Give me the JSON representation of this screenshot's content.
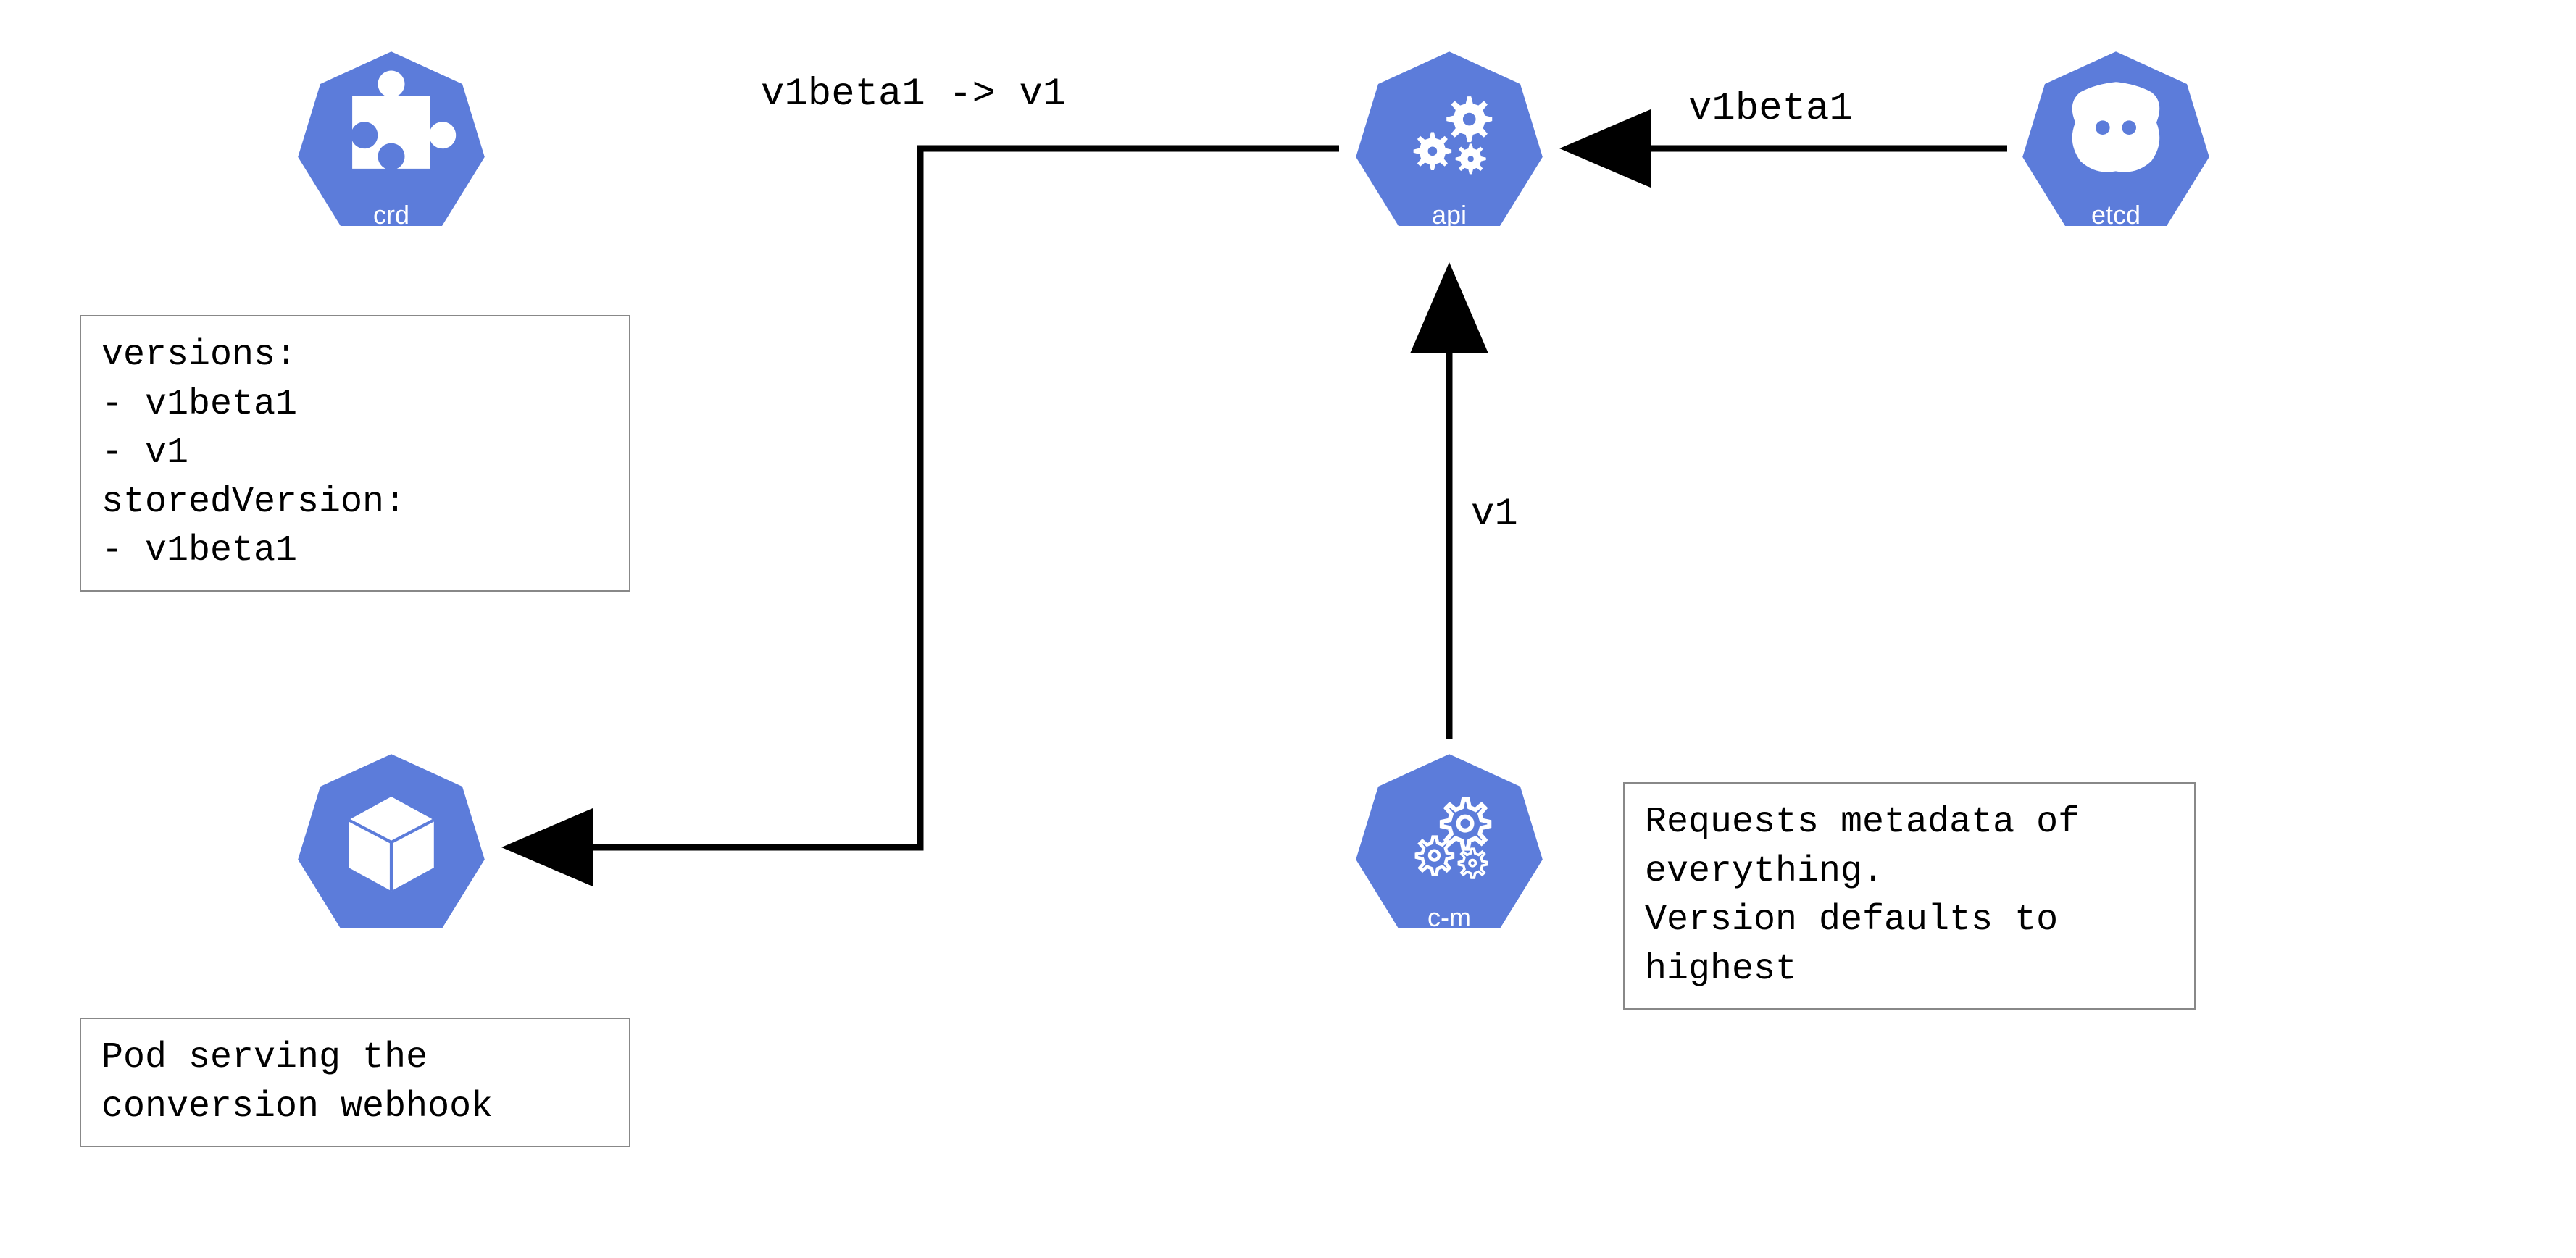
{
  "nodes": {
    "crd": {
      "label": "crd"
    },
    "api": {
      "label": "api"
    },
    "etcd": {
      "label": "etcd"
    },
    "pod": {
      "label": ""
    },
    "cm": {
      "label": "c-m"
    }
  },
  "boxes": {
    "crd_versions": "versions:\n- v1beta1\n- v1\nstoredVersion:\n- v1beta1",
    "pod_desc": "Pod serving the\nconversion webhook",
    "cm_desc": "Requests metadata of\neverything.\nVersion defaults to\nhighest"
  },
  "edges": {
    "api_to_pod": "v1beta1 -> v1",
    "etcd_to_api": "v1beta1",
    "cm_to_api": "v1"
  },
  "colors": {
    "k8s_blue": "#5c7cda",
    "white": "#ffffff",
    "black": "#000000",
    "border": "#888888"
  }
}
